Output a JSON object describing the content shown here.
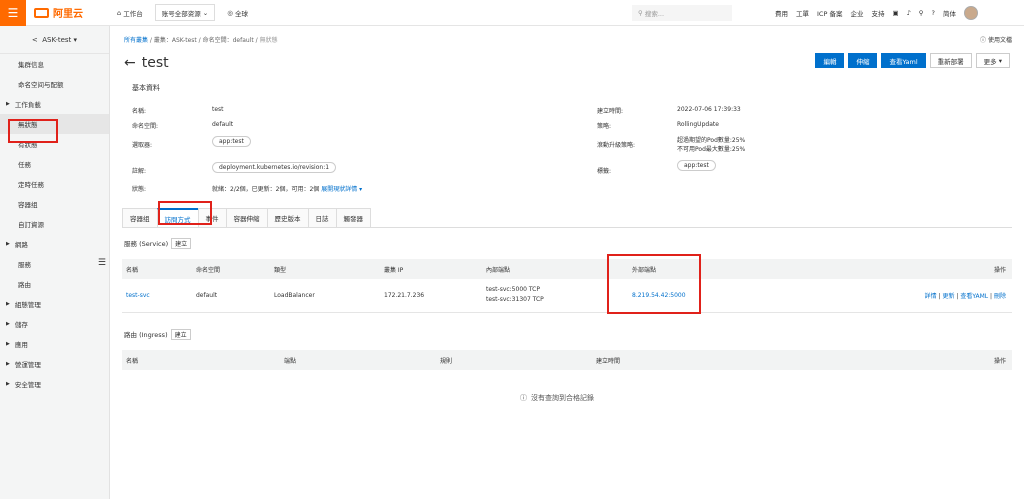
{
  "topbar": {
    "logo_text": "阿里云",
    "workbench": "工作台",
    "resource_select": "账号全部资源",
    "region": "全球",
    "search_placeholder": "搜索...",
    "nav": [
      "費用",
      "工單",
      "ICP 备案",
      "企业",
      "支持"
    ],
    "lang": "简体"
  },
  "sidebar": {
    "cluster": "ASK-test",
    "items": [
      {
        "label": "集群信息",
        "type": "item"
      },
      {
        "label": "命名空间与配额",
        "type": "item"
      },
      {
        "label": "工作負載",
        "type": "group"
      },
      {
        "label": "無狀態",
        "type": "item",
        "active": true
      },
      {
        "label": "有狀態",
        "type": "item"
      },
      {
        "label": "任務",
        "type": "item"
      },
      {
        "label": "定時任務",
        "type": "item"
      },
      {
        "label": "容器组",
        "type": "item"
      },
      {
        "label": "自訂資源",
        "type": "item"
      },
      {
        "label": "網路",
        "type": "group"
      },
      {
        "label": "服務",
        "type": "item"
      },
      {
        "label": "路由",
        "type": "item"
      },
      {
        "label": "組態管理",
        "type": "group"
      },
      {
        "label": "儲存",
        "type": "group"
      },
      {
        "label": "應用",
        "type": "group"
      },
      {
        "label": "營運管理",
        "type": "group"
      },
      {
        "label": "安全管理",
        "type": "group"
      }
    ]
  },
  "breadcrumb": {
    "all_clusters": "所有叢集",
    "cluster": "叢集：ASK-test",
    "namespace": "命名空間：default",
    "current": "無狀態"
  },
  "help": "使用文檔",
  "page": {
    "title": "test"
  },
  "actions": {
    "edit": "編輯",
    "scale": "伸縮",
    "view_yaml": "查看Yaml",
    "redeploy": "重新部署",
    "more": "更多"
  },
  "basic": {
    "section_title": "基本資料",
    "name_label": "名稱:",
    "name_value": "test",
    "ns_label": "命名空間:",
    "ns_value": "default",
    "selector_label": "選取器:",
    "selector_value": "app:test",
    "annotation_label": "註解:",
    "annotation_value": "deployment.kubernetes.io/revision:1",
    "status_label": "狀態:",
    "status_value": "就緒：2/2個，已更新：2個，可用：2個",
    "status_link": "展開現狀詳情",
    "created_label": "建立時間:",
    "created_value": "2022-07-06 17:39:33",
    "strategy_label": "策略:",
    "strategy_value": "RollingUpdate",
    "rolling_label": "滾動升級策略:",
    "rolling_value1": "超過期望的Pod數量:25%",
    "rolling_value2": "不可用Pod最大數量:25%",
    "tag_label": "標籤:",
    "tag_value": "app:test"
  },
  "tabs": [
    "容器组",
    "訪問方式",
    "事件",
    "容器伸縮",
    "歷史版本",
    "日誌",
    "觸發器"
  ],
  "service": {
    "title": "服務 (Service)",
    "create": "建立",
    "columns": [
      "名稱",
      "命名空間",
      "類型",
      "叢集 IP",
      "內部端點",
      "外部端點",
      "操作"
    ],
    "rows": [
      {
        "name": "test-svc",
        "namespace": "default",
        "type": "LoadBalancer",
        "cluster_ip": "172.21.7.236",
        "internal1": "test-svc:5000 TCP",
        "internal2": "test-svc:31307 TCP",
        "external": "8.219.54.42:5000",
        "ops": [
          "詳情",
          "更新",
          "查看YAML",
          "刪除"
        ]
      }
    ]
  },
  "ingress": {
    "title": "路由 (Ingress)",
    "create": "建立",
    "columns": [
      "名稱",
      "端點",
      "規則",
      "建立時間",
      "操作"
    ],
    "empty": "沒有查詢到合格記錄"
  },
  "colors": {
    "accent": "#0070cc",
    "brand": "#ff6a00",
    "highlight": "#e0211a"
  }
}
